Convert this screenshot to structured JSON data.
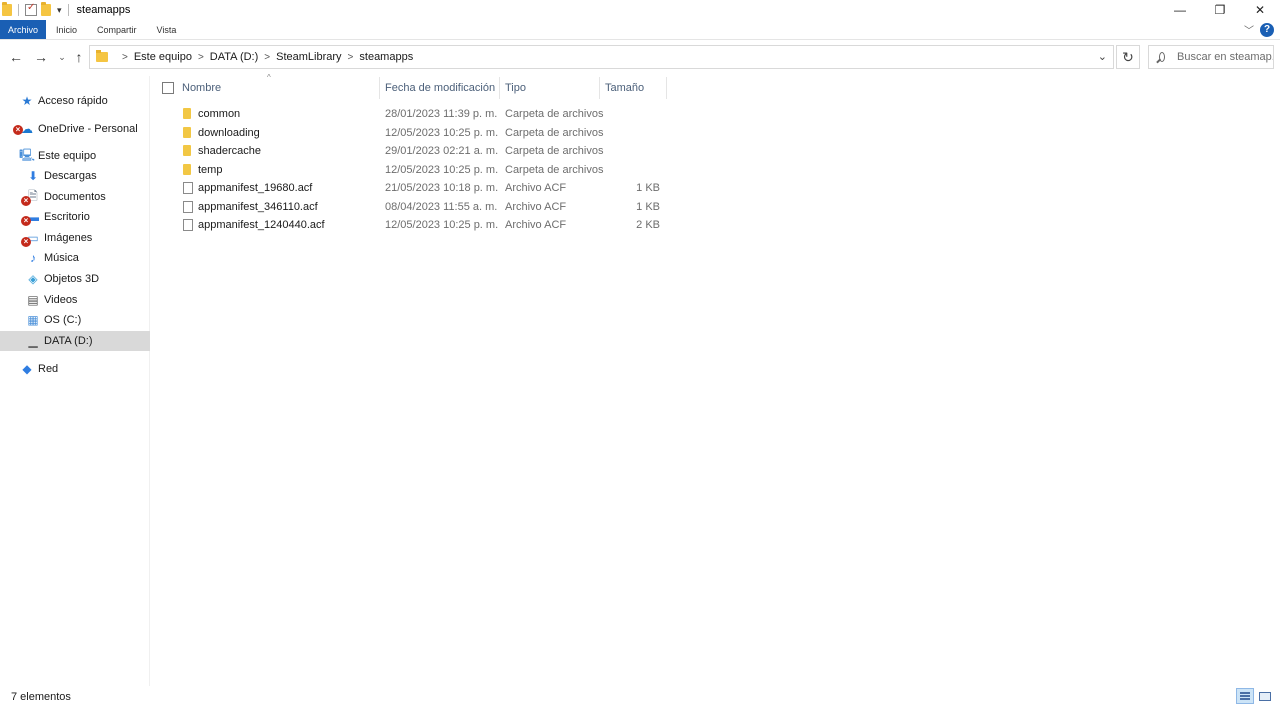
{
  "window": {
    "title": "steamapps"
  },
  "window_controls": {
    "minimize": "—",
    "maximize": "❐",
    "close": "✕"
  },
  "ribbon": {
    "tabs": [
      "Archivo",
      "Inicio",
      "Compartir",
      "Vista"
    ]
  },
  "address_bar": {
    "crumbs": [
      "Este equipo",
      "DATA (D:)",
      "SteamLibrary",
      "steamapps"
    ]
  },
  "search": {
    "placeholder": "Buscar en steamap..."
  },
  "sidebar": {
    "items": [
      {
        "label": "Acceso rápido",
        "icon": "star-icon",
        "color": "#2a7ad5"
      },
      {
        "label": "OneDrive - Personal",
        "icon": "cloud-icon",
        "color": "#1b78d0",
        "error": true
      },
      {
        "label": "Este equipo",
        "icon": "computer-icon",
        "color": "#4a90d9"
      },
      {
        "label": "Descargas",
        "icon": "download-icon",
        "color": "#2f7de1"
      },
      {
        "label": "Documentos",
        "icon": "document-icon",
        "color": "#6b7a8c",
        "error": true
      },
      {
        "label": "Escritorio",
        "icon": "desktop-icon",
        "color": "#2f7de1",
        "error": true
      },
      {
        "label": "Imágenes",
        "icon": "pictures-icon",
        "color": "#4a90d9",
        "error": true
      },
      {
        "label": "Música",
        "icon": "music-icon",
        "color": "#2f7de1"
      },
      {
        "label": "Objetos 3D",
        "icon": "cube-icon",
        "color": "#3aa0d8"
      },
      {
        "label": "Videos",
        "icon": "film-icon",
        "color": "#555555"
      },
      {
        "label": "OS (C:)",
        "icon": "os-drive-icon",
        "color": "#4a90d9"
      },
      {
        "label": "DATA (D:)",
        "icon": "drive-icon",
        "color": "#666666",
        "selected": true
      },
      {
        "label": "Red",
        "icon": "network-icon",
        "color": "#2f7de1"
      }
    ]
  },
  "columns": {
    "name": "Nombre",
    "date": "Fecha de modificación",
    "type": "Tipo",
    "size": "Tamaño"
  },
  "files": [
    {
      "name": "common",
      "date": "28/01/2023 11:39 p. m.",
      "type": "Carpeta de archivos",
      "size": "",
      "kind": "folder"
    },
    {
      "name": "downloading",
      "date": "12/05/2023 10:25 p. m.",
      "type": "Carpeta de archivos",
      "size": "",
      "kind": "folder"
    },
    {
      "name": "shadercache",
      "date": "29/01/2023 02:21 a. m.",
      "type": "Carpeta de archivos",
      "size": "",
      "kind": "folder"
    },
    {
      "name": "temp",
      "date": "12/05/2023 10:25 p. m.",
      "type": "Carpeta de archivos",
      "size": "",
      "kind": "folder"
    },
    {
      "name": "appmanifest_19680.acf",
      "date": "21/05/2023 10:18 p. m.",
      "type": "Archivo ACF",
      "size": "1 KB",
      "kind": "file"
    },
    {
      "name": "appmanifest_346110.acf",
      "date": "08/04/2023 11:55 a. m.",
      "type": "Archivo ACF",
      "size": "1 KB",
      "kind": "file"
    },
    {
      "name": "appmanifest_1240440.acf",
      "date": "12/05/2023 10:25 p. m.",
      "type": "Archivo ACF",
      "size": "2 KB",
      "kind": "file"
    }
  ],
  "status": {
    "count": "7 elementos"
  },
  "colors": {
    "accent": "#1a5fb4",
    "folder": "#f2c744",
    "selected_bg": "#d9d9d9"
  }
}
